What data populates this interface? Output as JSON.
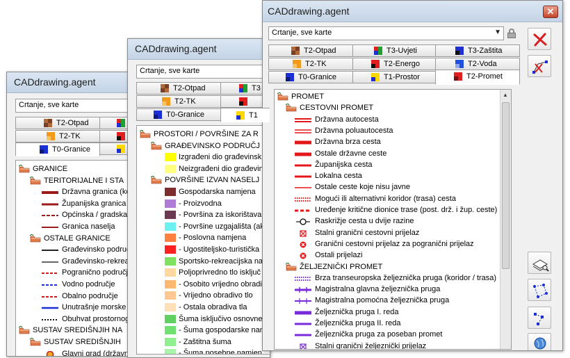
{
  "app_title": "CADdrawing.agent",
  "combo_value": "Crtanje, sve karte",
  "tabs": {
    "t2_otpad": "T2-Otpad",
    "t3_uvjeti": "T3-Uvjeti",
    "t3_zastita": "T3-Zaštita",
    "t2_tk": "T2-TK",
    "t2_energo": "T2-Energo",
    "t2_voda": "T2-Voda",
    "t0_granice": "T0-Granice",
    "t1_prostor": "T1-Prostor",
    "t2_promet": "T2-Promet",
    "w2_t3": "T3",
    "w2_t1": "T1"
  },
  "colors": {
    "road": "#e3171a",
    "rail": "#7a2bd9",
    "boundary_dark": "#9b1b1b",
    "boundary_blue": "#1a2fd6",
    "folder": "#e07a4a",
    "tool_red": "#d81f1f"
  },
  "win1": {
    "tree": [
      {
        "level": 0,
        "type": "folder",
        "label": "GRANICE"
      },
      {
        "level": 1,
        "type": "folder",
        "label": "TERITORIJALNE I STA"
      },
      {
        "level": 2,
        "type": "line",
        "label": "Državna granica (ko",
        "sym": "line-dark-thick"
      },
      {
        "level": 2,
        "type": "line",
        "label": "Županijska granica",
        "sym": "line-dark"
      },
      {
        "level": 2,
        "type": "line",
        "label": "Općinska / gradska",
        "sym": "line-dark-dash"
      },
      {
        "level": 2,
        "type": "line",
        "label": "Granica naselja",
        "sym": "line-dark-thin"
      },
      {
        "level": 1,
        "type": "folder",
        "label": "OSTALE GRANICE"
      },
      {
        "level": 2,
        "type": "line",
        "label": "Građevinsko područ",
        "sym": "line-black"
      },
      {
        "level": 2,
        "type": "line",
        "label": "Građevinsko-rekreacijsk",
        "sym": "line-black-thin"
      },
      {
        "level": 2,
        "type": "line",
        "label": "Pogranično područje",
        "sym": "line-red-dash"
      },
      {
        "level": 2,
        "type": "line",
        "label": "Vodno područje",
        "sym": "line-blue-dash"
      },
      {
        "level": 2,
        "type": "line",
        "label": "Obalno područje",
        "sym": "line-red-dash"
      },
      {
        "level": 2,
        "type": "line",
        "label": "Unutrašnje morske v",
        "sym": "line-blue"
      },
      {
        "level": 2,
        "type": "line",
        "label": "Obuhvat prostornog",
        "sym": "line-black-dot"
      },
      {
        "level": 0,
        "type": "folder",
        "label": "SUSTAV SREDIŠNJIH NA"
      },
      {
        "level": 1,
        "type": "folder",
        "label": "SUSTAV SREDIŠNJIH"
      },
      {
        "level": 2,
        "type": "point",
        "label": "Glavni grad (državn",
        "sym": "point-orange"
      }
    ]
  },
  "win2": {
    "tree": [
      {
        "level": 0,
        "type": "folder",
        "label": "PROSTORI / POVRŠINE ZA R"
      },
      {
        "level": 1,
        "type": "folder",
        "label": "GRAĐEVINSKO PODRUČJ"
      },
      {
        "level": 2,
        "type": "fill",
        "label": "Izgrađeni dio građevinsk",
        "fill": "#ffff00"
      },
      {
        "level": 2,
        "type": "fill",
        "label": "Neizgrađeni dio građevin",
        "fill": "#ffff80"
      },
      {
        "level": 1,
        "type": "folder",
        "label": "POVRŠINE IZVAN NASELJ"
      },
      {
        "level": 2,
        "type": "fill",
        "label": "Gospodarska namjena",
        "fill": "#7d2d2d"
      },
      {
        "level": 2,
        "type": "fill",
        "label": "- Proizvodna",
        "fill": "#b07bd6"
      },
      {
        "level": 2,
        "type": "fill",
        "label": "- Površina za iskorištava",
        "fill": "#6b3a52"
      },
      {
        "level": 2,
        "type": "fill",
        "label": "- Površine uzgajališta (ak",
        "fill": "#6ff0f0"
      },
      {
        "level": 2,
        "type": "fill",
        "label": "- Poslovna namjena",
        "fill": "#ff8040"
      },
      {
        "level": 2,
        "type": "fill",
        "label": "- Ugostiteljsko-turistička",
        "fill": "#ff2020"
      },
      {
        "level": 2,
        "type": "fill",
        "label": "Sportsko-rekreacijska na",
        "fill": "#80e060"
      },
      {
        "level": 2,
        "type": "fill",
        "label": "Poljoprivredno tlo isključ",
        "fill": "#ffd8a0"
      },
      {
        "level": 2,
        "type": "fill",
        "label": "- Osobito vrijedno obradi",
        "fill": "#ffb870"
      },
      {
        "level": 2,
        "type": "fill",
        "label": "- Vrijedno obradivo tlo",
        "fill": "#ffc890"
      },
      {
        "level": 2,
        "type": "fill",
        "label": "- Ostala obradiva tla",
        "fill": "#ffe0b8"
      },
      {
        "level": 2,
        "type": "fill",
        "label": "Šuma isključivo osnovne",
        "fill": "#60d060"
      },
      {
        "level": 2,
        "type": "fill",
        "label": "- Šuma gospodarske nan",
        "fill": "#70e070"
      },
      {
        "level": 2,
        "type": "fill",
        "label": "- Zaštitna šuma",
        "fill": "#90f090"
      },
      {
        "level": 2,
        "type": "fill",
        "label": "- Šuma posebne namjen",
        "fill": "#a8f4a8"
      }
    ]
  },
  "win3": {
    "tree": [
      {
        "level": 0,
        "type": "folder",
        "label": "PROMET"
      },
      {
        "level": 1,
        "type": "folder",
        "label": "CESTOVNI PROMET"
      },
      {
        "level": 2,
        "type": "line",
        "label": "Državna autocesta",
        "sym": "road-double"
      },
      {
        "level": 2,
        "type": "line",
        "label": "Državna poluautocesta",
        "sym": "road-double-thin"
      },
      {
        "level": 2,
        "type": "line",
        "label": "Državna brza cesta",
        "sym": "road-thick"
      },
      {
        "level": 2,
        "type": "line",
        "label": "Ostale državne ceste",
        "sym": "road-thick"
      },
      {
        "level": 2,
        "type": "line",
        "label": "Županijska cesta",
        "sym": "road-medium"
      },
      {
        "level": 2,
        "type": "line",
        "label": "Lokalna cesta",
        "sym": "road-medium"
      },
      {
        "level": 2,
        "type": "line",
        "label": "Ostale ceste koje nisu javne",
        "sym": "road-thin"
      },
      {
        "level": 2,
        "type": "line",
        "label": "Mogući ili alternativni koridor (trasa) cesta",
        "sym": "road-dotted"
      },
      {
        "level": 2,
        "type": "line",
        "label": "Uređenje kritične dionice trase (post. drž. i žup. ceste)",
        "sym": "road-dash"
      },
      {
        "level": 2,
        "type": "point",
        "label": "Raskrižje cesta u dvije razine",
        "sym": "junction"
      },
      {
        "level": 2,
        "type": "point",
        "label": "Stalni granični cestovni prijelaz",
        "sym": "box-x"
      },
      {
        "level": 2,
        "type": "point",
        "label": "Granični cestovni prijelaz za pogranični prijelaz",
        "sym": "circle-x"
      },
      {
        "level": 2,
        "type": "point",
        "label": "Ostali prijelazi",
        "sym": "circle-x"
      },
      {
        "level": 1,
        "type": "folder",
        "label": "ŽELJEZNIČKI PROMET"
      },
      {
        "level": 2,
        "type": "line",
        "label": "Brza transeuropska željeznička pruga (koridor / trasa)",
        "sym": "rail-dotted"
      },
      {
        "level": 2,
        "type": "line",
        "label": "Magistralna glavna željeznička pruga",
        "sym": "rail-ticks"
      },
      {
        "level": 2,
        "type": "line",
        "label": "Magistralna pomoćna željeznička pruga",
        "sym": "rail-ticks-thin"
      },
      {
        "level": 2,
        "type": "line",
        "label": "Željeznička pruga I. reda",
        "sym": "rail-thick"
      },
      {
        "level": 2,
        "type": "line",
        "label": "Željeznička pruga II. reda",
        "sym": "rail-medium"
      },
      {
        "level": 2,
        "type": "line",
        "label": "Željeznička pruga za poseban promet",
        "sym": "rail-medium"
      },
      {
        "level": 2,
        "type": "point",
        "label": "Stalni granični željeznički prijelaz",
        "sym": "box-x-purple"
      }
    ]
  }
}
